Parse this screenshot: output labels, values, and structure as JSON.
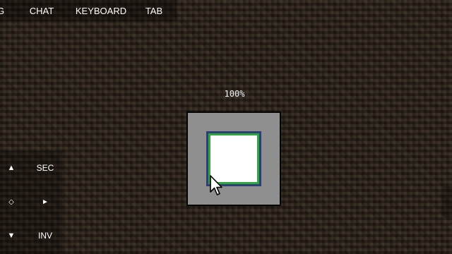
{
  "topbar": {
    "cut_label": "G",
    "chat_label": "CHAT",
    "keyboard_label": "KEYBOARD",
    "tab_label": "TAB"
  },
  "controls": {
    "up_glyph": "▲",
    "sec_label": "SEC",
    "diamond_glyph": "◇",
    "right_glyph": "►",
    "down_glyph": "▼",
    "inv_label": "INV"
  },
  "zoom": {
    "label": "100%"
  },
  "icons": {
    "cursor": "mouse-pointer-icon",
    "up": "arrow-up-icon",
    "down": "arrow-down-icon",
    "right": "arrow-right-icon",
    "diamond": "diamond-icon"
  },
  "colors": {
    "frame_bg": "#8f8f8f",
    "slot_outer": "#2f3d7a",
    "slot_inner_border": "#2fa83a",
    "slot_fill": "#ffffff"
  }
}
